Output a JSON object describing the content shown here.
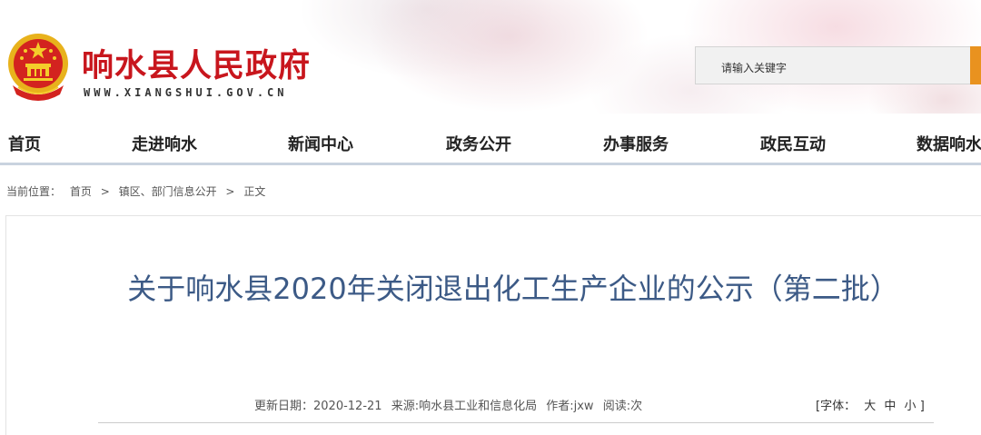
{
  "header": {
    "site_title": "响水县人民政府",
    "site_url": "WWW.XIANGSHUI.GOV.CN",
    "emblem_icon": "national-emblem-icon",
    "search_placeholder": "请输入关键字",
    "search_button_color": "#e9921f",
    "title_color": "#c8161d"
  },
  "nav": {
    "items": [
      {
        "label": "首页"
      },
      {
        "label": "走进响水"
      },
      {
        "label": "新闻中心"
      },
      {
        "label": "政务公开"
      },
      {
        "label": "办事服务"
      },
      {
        "label": "政民互动"
      },
      {
        "label": "数据响水"
      }
    ]
  },
  "breadcrumb": {
    "prefix": "当前位置：",
    "items": [
      "首页",
      "镇区、部门信息公开",
      "正文"
    ],
    "separator": ">"
  },
  "article": {
    "title": "关于响水县2020年关闭退出化工生产企业的公示（第二批）",
    "title_color": "#3c5a86",
    "update_date": "更新日期：2020-12-21",
    "source": "来源:响水县工业和信息化局",
    "author": "作者:jxw",
    "reads": "阅读:次",
    "font_size_label": "[字体：",
    "font_large": "大",
    "font_medium": "中",
    "font_small": "小",
    "font_close": "]"
  }
}
